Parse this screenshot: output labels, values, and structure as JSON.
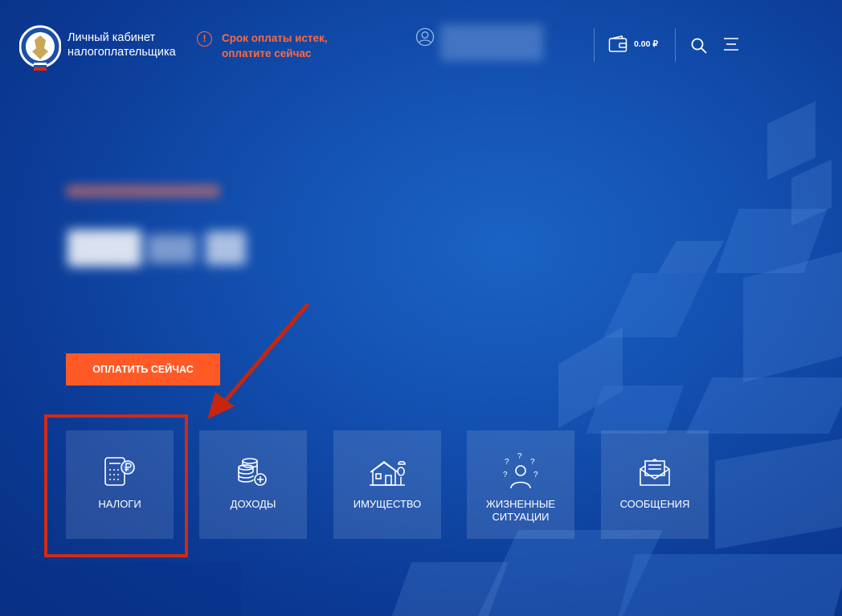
{
  "header": {
    "app_title_line1": "Личный кабинет",
    "app_title_line2": "налогоплательщика",
    "warning_line1": "Срок оплаты истек,",
    "warning_line2": "оплатите сейчас",
    "warning_icon": "!",
    "balance": "0.00 ₽"
  },
  "main": {
    "pay_button": "ОПЛАТИТЬ СЕЙЧАС"
  },
  "tiles": [
    {
      "label_line1": "НАЛОГИ",
      "label_line2": "",
      "icon": "calculator-ruble-icon"
    },
    {
      "label_line1": "ДОХОДЫ",
      "label_line2": "",
      "icon": "coins-plus-icon"
    },
    {
      "label_line1": "ИМУЩЕСТВО",
      "label_line2": "",
      "icon": "house-icon"
    },
    {
      "label_line1": "ЖИЗНЕННЫЕ",
      "label_line2": "СИТУАЦИИ",
      "icon": "person-questions-icon"
    },
    {
      "label_line1": "СООБЩЕНИЯ",
      "label_line2": "",
      "icon": "envelope-icon"
    }
  ],
  "colors": {
    "accent": "#ff5a26",
    "warning": "#ff6a3d",
    "highlight": "#d22a14",
    "background": "#1350b0"
  }
}
